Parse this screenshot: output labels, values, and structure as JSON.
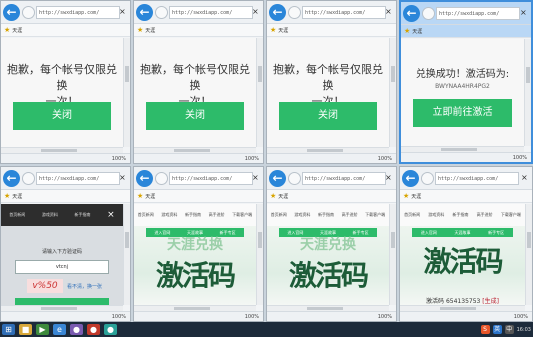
{
  "browser": {
    "url": "http://swxdiapp.com/",
    "favorites_label": "天涯",
    "zoom": "100%"
  },
  "sorry_dialog": {
    "message_line1": "抱歉，每个帐号仅限兑换",
    "message_line2": "一次！",
    "close_label": "关闭"
  },
  "success_dialog": {
    "message_line1": "兑换成功！激活码为:",
    "code": "BWYNAA4HR4PG2",
    "go_label": "立即前往激活"
  },
  "site_nav": {
    "items": [
      "首页新闻",
      "游戏资料",
      "新手指南",
      "高手进阶",
      "下载客户端"
    ]
  },
  "captcha_panel": {
    "prompt": "请输入下方验证码",
    "input_value": "vtcnj",
    "captcha_text": "v%50",
    "refresh_label": "看不清，换一张"
  },
  "banner": {
    "tabs": [
      "进入官网",
      "天涯故事",
      "新手专区"
    ],
    "subtitle": "天涯兑换",
    "headline": "激活码",
    "result_prefix": "激活码",
    "result_code": "654135753",
    "result_tag": "[生成]"
  },
  "taskbar": {
    "tray_items": [
      "S",
      "英",
      "中"
    ],
    "clock": "16:03"
  }
}
